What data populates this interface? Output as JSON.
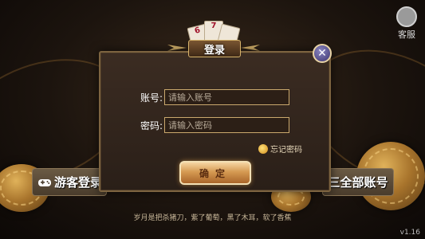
{
  "customer_service": {
    "label": "客服",
    "icon": "customer-service-icon"
  },
  "dialog": {
    "title": "登录",
    "title_cards": [
      "6",
      "7",
      ""
    ],
    "account_label": "账号:",
    "account_placeholder": "请输入账号",
    "password_label": "密码:",
    "password_placeholder": "请输入密码",
    "forgot_label": "忘记密码",
    "confirm_label": "确定",
    "close_icon": "close-icon"
  },
  "guest_login_label": "游客登录",
  "all_accounts_label": "三全部账号",
  "tagline": "岁月是把杀猪刀，紫了葡萄，黑了木耳，软了香蕉",
  "version": "v1.16",
  "colors": {
    "gold_border": "#caa86d",
    "panel_bg": "#2a1f18",
    "button_gold": "#d59a52"
  }
}
